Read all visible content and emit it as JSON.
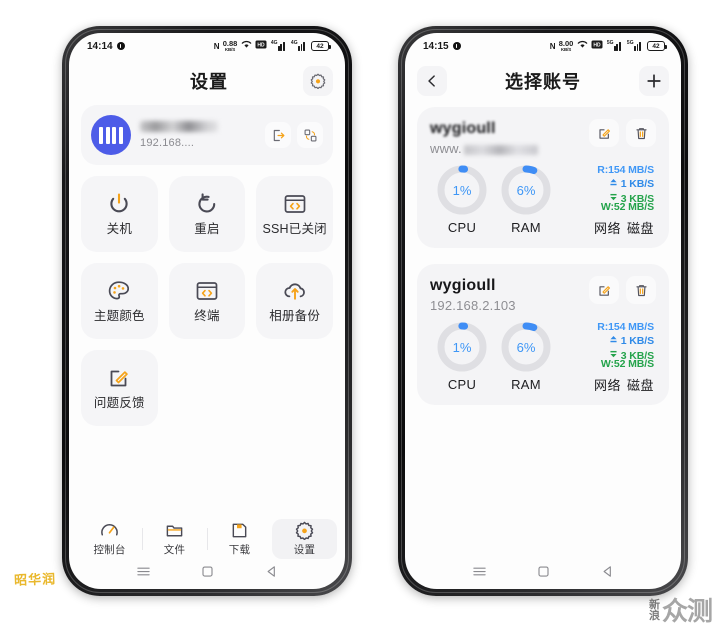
{
  "phone1": {
    "statusbar": {
      "time": "14:14",
      "net_label": "N",
      "speed_value": "0.88",
      "speed_unit": "KB/S",
      "signal1": "4G",
      "signal2": "4G",
      "battery": "42"
    },
    "header": {
      "title": "设置",
      "gear_icon": "gear-icon"
    },
    "profile": {
      "logo_icon": "nas-server-icon",
      "name_masked": "",
      "ip": "192.168....",
      "actions": [
        {
          "name": "logout-icon",
          "label": ""
        },
        {
          "name": "switch-account-icon",
          "label": ""
        }
      ]
    },
    "tiles": [
      {
        "label": "关机",
        "icon": "power-off-icon"
      },
      {
        "label": "重启",
        "icon": "restart-icon"
      },
      {
        "label": "SSH已关闭",
        "icon": "ssh-terminal-icon"
      },
      {
        "label": "主题颜色",
        "icon": "palette-icon"
      },
      {
        "label": "终端",
        "icon": "terminal-icon"
      },
      {
        "label": "相册备份",
        "icon": "cloud-upload-icon"
      },
      {
        "label": "问题反馈",
        "icon": "feedback-edit-icon"
      }
    ],
    "tabs": [
      {
        "label": "控制台",
        "icon": "dashboard-icon",
        "active": false
      },
      {
        "label": "文件",
        "icon": "folder-icon",
        "active": false
      },
      {
        "label": "下载",
        "icon": "download-save-icon",
        "active": false
      },
      {
        "label": "设置",
        "icon": "settings-gear-icon",
        "active": true
      }
    ],
    "navbar": [
      {
        "name": "recents-icon"
      },
      {
        "name": "home-icon"
      },
      {
        "name": "back-icon"
      }
    ]
  },
  "phone2": {
    "statusbar": {
      "time": "14:15",
      "net_label": "N",
      "speed_value": "8.00",
      "speed_unit": "KB/S",
      "signal1": "5G",
      "signal2": "5G",
      "battery": "42"
    },
    "header": {
      "back_icon": "back-chevron-icon",
      "title": "选择账号",
      "add_icon": "add-plus-icon"
    },
    "accounts": [
      {
        "name": "wygioull",
        "name_blurred": true,
        "sub_prefix": "www.",
        "sub_blurred": true,
        "sub": "",
        "edit_icon": "edit-pencil-icon",
        "delete_icon": "trash-delete-icon",
        "cpu": {
          "label": "CPU",
          "value": "1%",
          "percent": 1
        },
        "ram": {
          "label": "RAM",
          "value": "6%",
          "percent": 6
        },
        "net": {
          "upload": "1 KB/S",
          "download": "3 KB/S",
          "disk_read": "R:154 MB/S",
          "disk_write": "W:52 MB/S",
          "label_network": "网络",
          "label_disk": "磁盘"
        }
      },
      {
        "name": "wygioull",
        "name_blurred": false,
        "sub_prefix": "",
        "sub_blurred": false,
        "sub": "192.168.2.103",
        "edit_icon": "edit-pencil-icon",
        "delete_icon": "trash-delete-icon",
        "cpu": {
          "label": "CPU",
          "value": "1%",
          "percent": 1
        },
        "ram": {
          "label": "RAM",
          "value": "6%",
          "percent": 6
        },
        "net": {
          "upload": "1 KB/S",
          "download": "3 KB/S",
          "disk_read": "R:154 MB/S",
          "disk_write": "W:52 MB/S",
          "label_network": "网络",
          "label_disk": "磁盘"
        }
      }
    ],
    "navbar": [
      {
        "name": "recents-icon"
      },
      {
        "name": "home-icon"
      },
      {
        "name": "back-icon"
      }
    ]
  },
  "watermarks": {
    "left": "昭华润",
    "right_small_top": "新",
    "right_small_bottom": "浪",
    "right_big": "众测"
  },
  "colors": {
    "accent_orange": "#f5a31a",
    "accent_blue": "#4d5ce8",
    "gauge_blue": "#3f97f6",
    "green": "#24a34b",
    "card_bg": "#f4f4f6"
  }
}
